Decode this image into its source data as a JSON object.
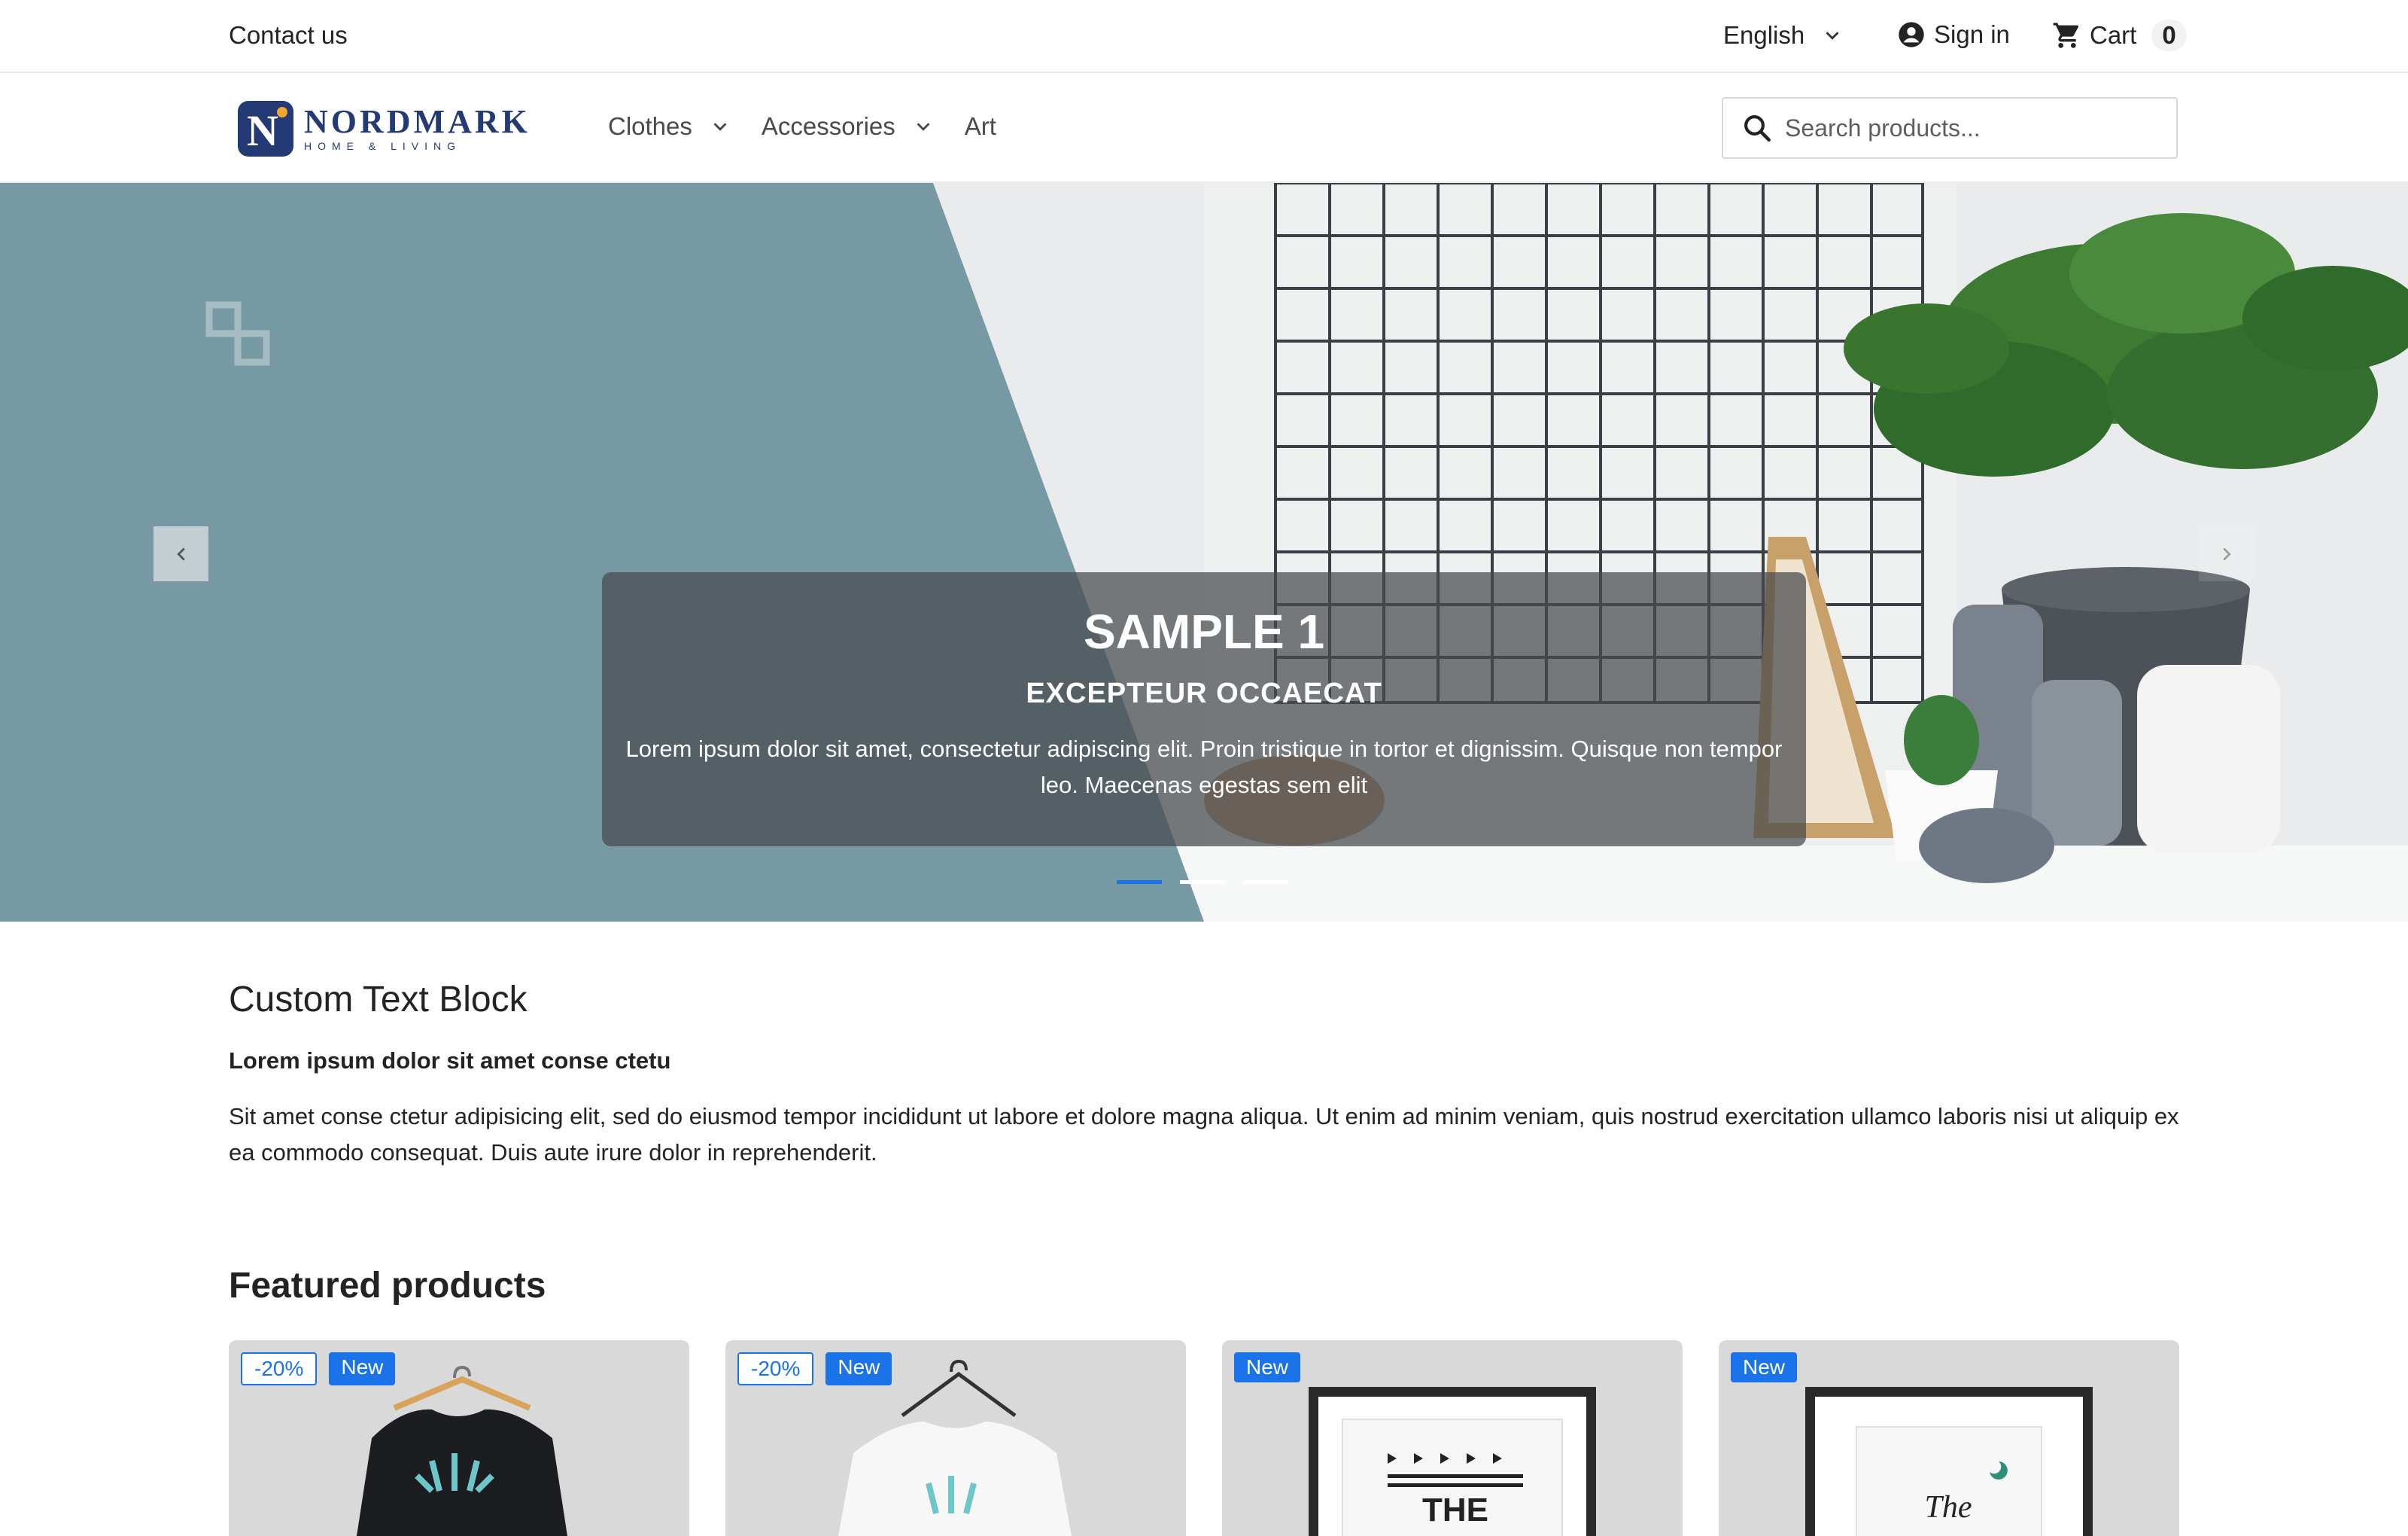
{
  "topbar": {
    "contact": "Contact us",
    "language": "English",
    "sign_in": "Sign in",
    "cart_label": "Cart",
    "cart_count": "0"
  },
  "header": {
    "logo_name": "NORDMARK",
    "logo_sub": "HOME & LIVING",
    "nav": [
      {
        "label": "Clothes",
        "has_dropdown": true
      },
      {
        "label": "Accessories",
        "has_dropdown": true
      },
      {
        "label": "Art",
        "has_dropdown": false
      }
    ],
    "search_placeholder": "Search products..."
  },
  "hero": {
    "title": "SAMPLE 1",
    "subtitle": "EXCEPTEUR OCCAECAT",
    "text": "Lorem ipsum dolor sit amet, consectetur adipiscing elit. Proin tristique in tortor et dignissim. Quisque non tempor leo. Maecenas egestas sem elit",
    "slide_count": 3,
    "active_slide": 1
  },
  "text_block": {
    "title": "Custom Text Block",
    "subtitle": "Lorem ipsum dolor sit amet conse ctetu",
    "body": "Sit amet conse ctetur adipisicing elit, sed do eiusmod tempor incididunt ut labore et dolore magna aliqua. Ut enim ad minim veniam, quis nostrud exercitation ullamco laboris nisi ut aliquip ex ea commodo consequat. Duis aute irure dolor in reprehenderit."
  },
  "featured": {
    "title": "Featured products",
    "products": [
      {
        "discount": "-20%",
        "badge": "New",
        "image": "black-tshirt"
      },
      {
        "discount": "-20%",
        "badge": "New",
        "image": "white-tshirt"
      },
      {
        "badge": "New",
        "image": "framed-poster-the"
      },
      {
        "badge": "New",
        "image": "framed-poster-script"
      }
    ]
  },
  "colors": {
    "accent": "#1a73e8",
    "brand": "#233a74",
    "hero_blue": "#7799a4"
  }
}
